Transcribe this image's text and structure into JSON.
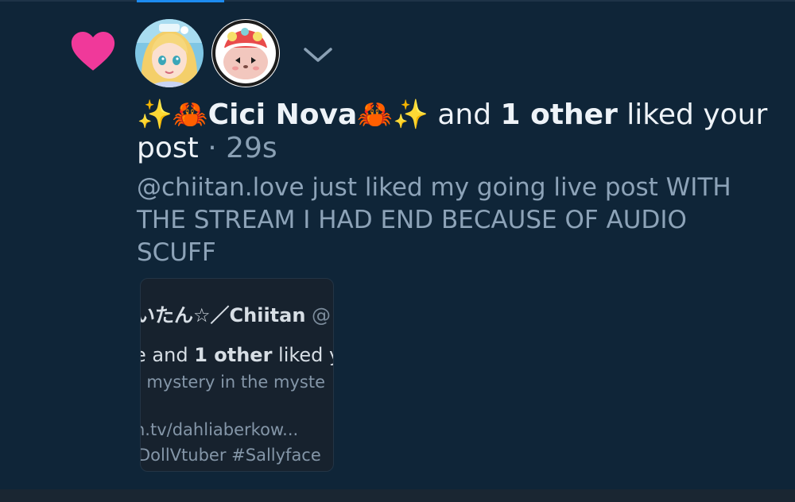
{
  "notification": {
    "headline_prefix": "✨🦀",
    "user_name": "Cici Nova",
    "headline_suffix_emoji": "🦀✨",
    "connector": " and ",
    "others": "1 other",
    "action": " liked your post",
    "separator": " · ",
    "time": "29s",
    "body": "@chiitan.love just liked my going live post WITH THE STREAM I HAD END BECAUSE OF AUDIO SCUFF"
  },
  "quoted_preview": {
    "name_line": "いたん☆／Chiitan",
    "handle_fragment": " @",
    "line2_prefix": "e and ",
    "line2_bold": "1 other",
    "line2_suffix": " liked y",
    "line3": "· mystery in the myste",
    "line4": "h.tv/dahliaberkow...",
    "line5": "DollVtuber #Sallyface"
  },
  "icons": {
    "like": "heart-icon",
    "expand": "chevron-down-icon"
  },
  "colors": {
    "heart": "#f0399a",
    "background": "#0f2538",
    "accent": "#1d8bf0"
  }
}
